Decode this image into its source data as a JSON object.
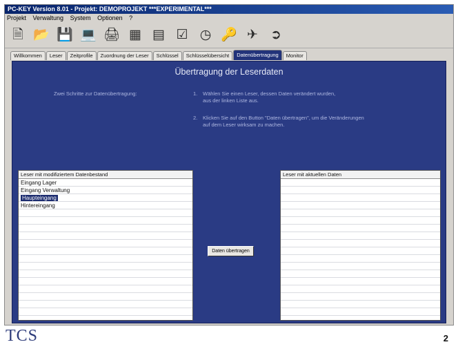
{
  "window": {
    "title": "PC-KEY Version 8.01 - Projekt: DEMOPROJEKT ***EXPERIMENTAL***"
  },
  "menubar": {
    "items": [
      "Projekt",
      "Verwaltung",
      "System",
      "Optionen",
      "?"
    ]
  },
  "toolbar": {
    "icons": [
      "new-document-icon",
      "open-folder-icon",
      "save-disk-icon",
      "monitor-icon",
      "print-icon",
      "calculator-icon",
      "table-icon",
      "checkbox-icon",
      "clock-icon",
      "key-icon",
      "reader-icon",
      "exit-icon"
    ]
  },
  "tabs": {
    "items": [
      "Willkommen",
      "Leser",
      "Zeitprofile",
      "Zuordnung der Leser",
      "Schlüssel",
      "Schlüsselübersicht",
      "Datenübertragung",
      "Monitor"
    ],
    "active_index": 6
  },
  "panel": {
    "title": "Übertragung der Leserdaten",
    "steps_label": "Zwei Schritte zur Datenübertragung:",
    "step1_num": "1.",
    "step1_text": "Wählen Sie einen Leser, dessen Daten verändert wurden,\naus der linken Liste aus.",
    "step2_num": "2.",
    "step2_text": "Klicken Sie auf den Button \"Daten übertragen\", um die Veränderungen\nauf dem Leser wirksam zu machen."
  },
  "left_list": {
    "header": "Leser mit modifiziertem Datenbestand",
    "items": [
      "Eingang Lager",
      "Eingang Verwaltung",
      "Haupteingang",
      "Hintereingang"
    ],
    "selected_index": 2
  },
  "right_list": {
    "header": "Leser mit aktuellen Daten",
    "items": []
  },
  "transfer_button": {
    "label": "Daten übertragen"
  },
  "footer": {
    "logo": "TCS",
    "page_number": "2"
  }
}
